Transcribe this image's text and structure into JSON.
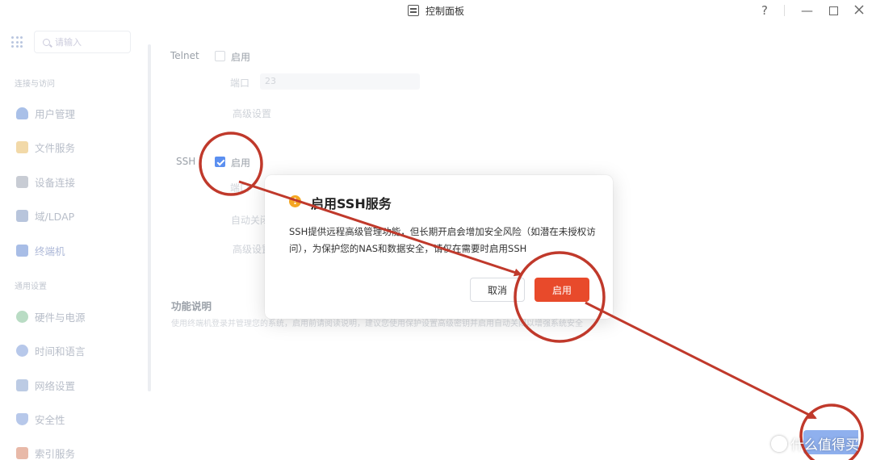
{
  "window": {
    "title": "控制面板",
    "help": "?",
    "minimize": "—"
  },
  "sidebar": {
    "search_placeholder": "请输入",
    "section_access": "连接与访问",
    "section_general": "通用设置",
    "items": [
      {
        "label": "用户管理",
        "icon": "user-icon",
        "color": "#a9c0e8"
      },
      {
        "label": "文件服务",
        "icon": "folder-icon",
        "color": "#f2d9a8"
      },
      {
        "label": "设备连接",
        "icon": "device-icon",
        "color": "#c8ccd4"
      },
      {
        "label": "域/LDAP",
        "icon": "domain-icon",
        "color": "#b8c5dc"
      },
      {
        "label": "终端机",
        "icon": "terminal-icon",
        "color": "#a8bde6"
      },
      {
        "label": "硬件与电源",
        "icon": "hardware-icon",
        "color": "#b9dcc4"
      },
      {
        "label": "时间和语言",
        "icon": "clock-icon",
        "color": "#b7c8ea"
      },
      {
        "label": "网络设置",
        "icon": "network-icon",
        "color": "#bccbe4"
      },
      {
        "label": "安全性",
        "icon": "shield-icon",
        "color": "#b7c8ea"
      },
      {
        "label": "索引服务",
        "icon": "index-icon",
        "color": "#e8b9a8"
      }
    ]
  },
  "main": {
    "telnet_label": "Telnet",
    "telnet_enable": "启用",
    "telnet_port_label": "端口",
    "telnet_port_value": "23",
    "telnet_advanced": "高级设置",
    "ssh_label": "SSH",
    "ssh_enable": "启用",
    "ssh_port_label": "端口",
    "ssh_autoclose_label": "自动关闭",
    "ssh_advanced": "高级设置",
    "func_title": "功能说明",
    "func_desc": "使用终端机登录并管理您的系统，启用前请阅读说明，建议您使用保护设置高级密钥并启用自动关闭以增强系统安全"
  },
  "dialog": {
    "title": "启用SSH服务",
    "warn_glyph": "!",
    "body": "SSH提供远程高级管理功能，但长期开启会增加安全风险（如潜在未授权访问），为保护您的NAS和数据安全，请仅在需要时启用SSH",
    "cancel_label": "取消",
    "ok_label": "启用"
  },
  "watermark": {
    "text": "什么值得买"
  },
  "colors": {
    "accent": "#5b8ff0",
    "danger": "#e84a2b",
    "warning": "#f5a623",
    "annotation": "#c0392b"
  }
}
